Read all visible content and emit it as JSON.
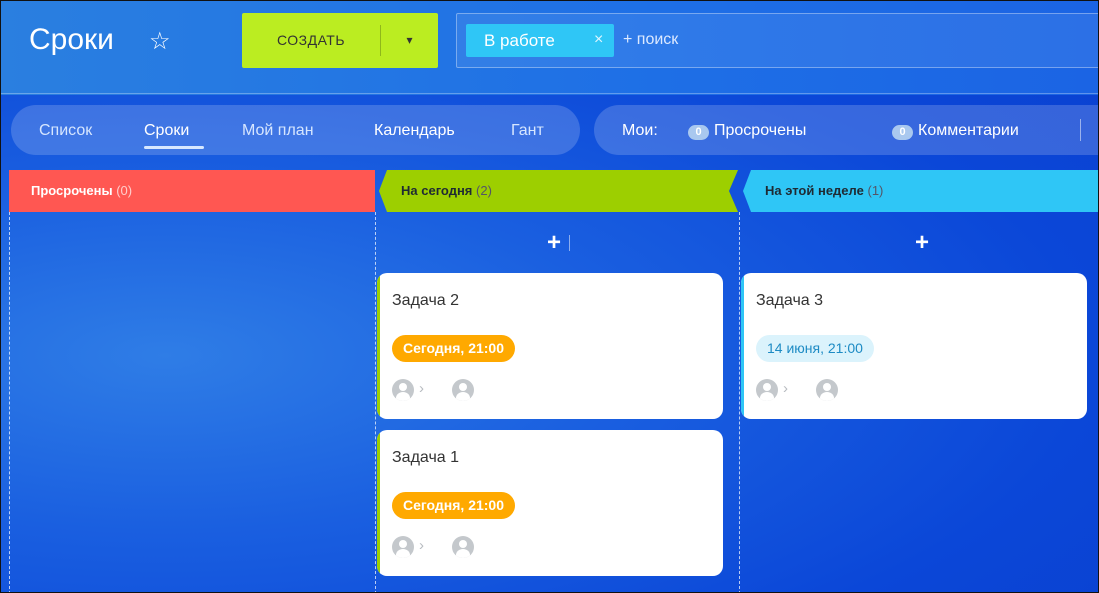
{
  "header": {
    "title": "Сроки",
    "star_icon": "star-outline-icon",
    "create_label": "СОЗДАТЬ",
    "create_arrow": "▾",
    "filter_chip": "В работе",
    "filter_chip_close": "×",
    "search_placeholder": "+ поиск"
  },
  "view_tabs": [
    {
      "label": "Список",
      "active": false
    },
    {
      "label": "Сроки",
      "active": true
    },
    {
      "label": "Мой план",
      "active": false
    },
    {
      "label": "Календарь",
      "active": false
    },
    {
      "label": "Гант",
      "active": false
    }
  ],
  "counters": {
    "label": "Мои:",
    "items": [
      {
        "count": "0",
        "label": "Просрочены"
      },
      {
        "count": "0",
        "label": "Комментарии"
      }
    ]
  },
  "columns": [
    {
      "title": "Просрочены",
      "count": "(0)",
      "color": "#ff5752"
    },
    {
      "title": "На сегодня",
      "count": "(2)",
      "color": "#9dcf00"
    },
    {
      "title": "На этой неделе",
      "count": "(1)",
      "color": "#2fc6f6"
    }
  ],
  "add_label": "+",
  "cards": [
    {
      "title": "Задача 2",
      "deadline": "Сегодня, 21:00",
      "column": "today"
    },
    {
      "title": "Задача 1",
      "deadline": "Сегодня, 21:00",
      "column": "today"
    },
    {
      "title": "Задача 3",
      "deadline": "14 июня, 21:00",
      "column": "week"
    }
  ],
  "arrow_glyph": "›",
  "colors": {
    "create_button": "#bbed21",
    "filter_chip": "#2fc6f6",
    "deadline_today": "#ffa900",
    "deadline_week_bg": "#dbf3fc",
    "card_bar_today": "#9dcf00",
    "card_bar_week": "#2fc6f6"
  }
}
